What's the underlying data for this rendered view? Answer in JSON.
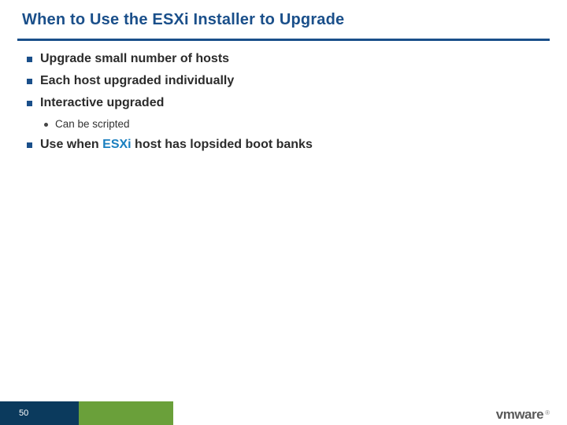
{
  "title": "When to Use the ESXi Installer to Upgrade",
  "bullets": [
    {
      "level": 1,
      "text": "Upgrade small number of hosts"
    },
    {
      "level": 1,
      "text": "Each host upgraded individually"
    },
    {
      "level": 1,
      "text": "Interactive upgraded"
    },
    {
      "level": 2,
      "text": "Can be scripted"
    },
    {
      "level": 1,
      "runs": [
        {
          "t": "Use when ",
          "accent": false
        },
        {
          "t": "ESXi",
          "accent": true
        },
        {
          "t": " host has lopsided boot banks",
          "accent": false
        }
      ]
    }
  ],
  "footer": {
    "page": "50",
    "brand": "vmware",
    "reg": "®"
  }
}
